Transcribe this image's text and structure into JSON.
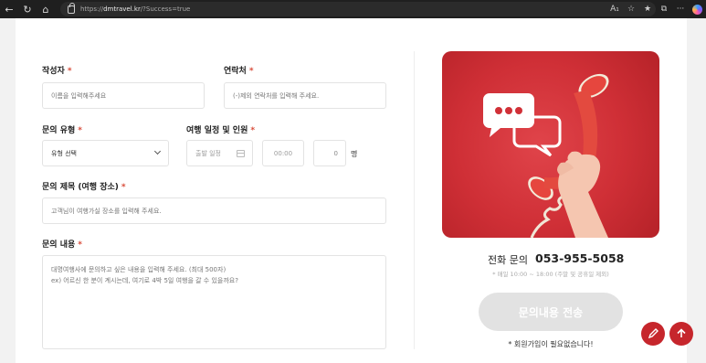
{
  "browser": {
    "url_scheme": "https://",
    "url_host": "dmtravel.kr",
    "url_path": "/?Success=true"
  },
  "form": {
    "author": {
      "label": "작성자",
      "required": "*",
      "placeholder": "이름을 입력해주세요"
    },
    "contact": {
      "label": "연락처",
      "required": "*",
      "placeholder": "(-)제외 연락처를 입력해 주세요."
    },
    "inquiry_type": {
      "label": "문의 유형",
      "required": "*",
      "selected": "유형 선택"
    },
    "schedule": {
      "label": "여행 일정 및 인원",
      "required": "*",
      "date_placeholder": "출발 일정",
      "time_value": "00:00",
      "people_value": "0",
      "people_unit": "명"
    },
    "subject": {
      "label": "문의 제목 (여행 장소)",
      "required": "*",
      "placeholder": "고객님이 여행가실 장소를 입력해 주세요."
    },
    "content": {
      "label": "문의 내용",
      "required": "*",
      "placeholder": "대명여행사에 문의하고 싶은 내용을 입력해 주세요. (최대 500자)\nex) 어르신 한 분이 계시는데, 여기로 4박 5일 여행을 갈 수 있을까요?"
    }
  },
  "sidebar": {
    "phone_label": "전화 문의",
    "phone_number": "053-955-5058",
    "hours": "* 매일 10:00 ~ 18:00 (주말 및 공휴일 제외)",
    "submit_label": "문의내용 전송",
    "note": "* 회원가입이 필요없습니다!"
  },
  "colors": {
    "accent": "#c6262c",
    "required": "#d84a38",
    "submit_disabled": "#e2e2e2"
  }
}
